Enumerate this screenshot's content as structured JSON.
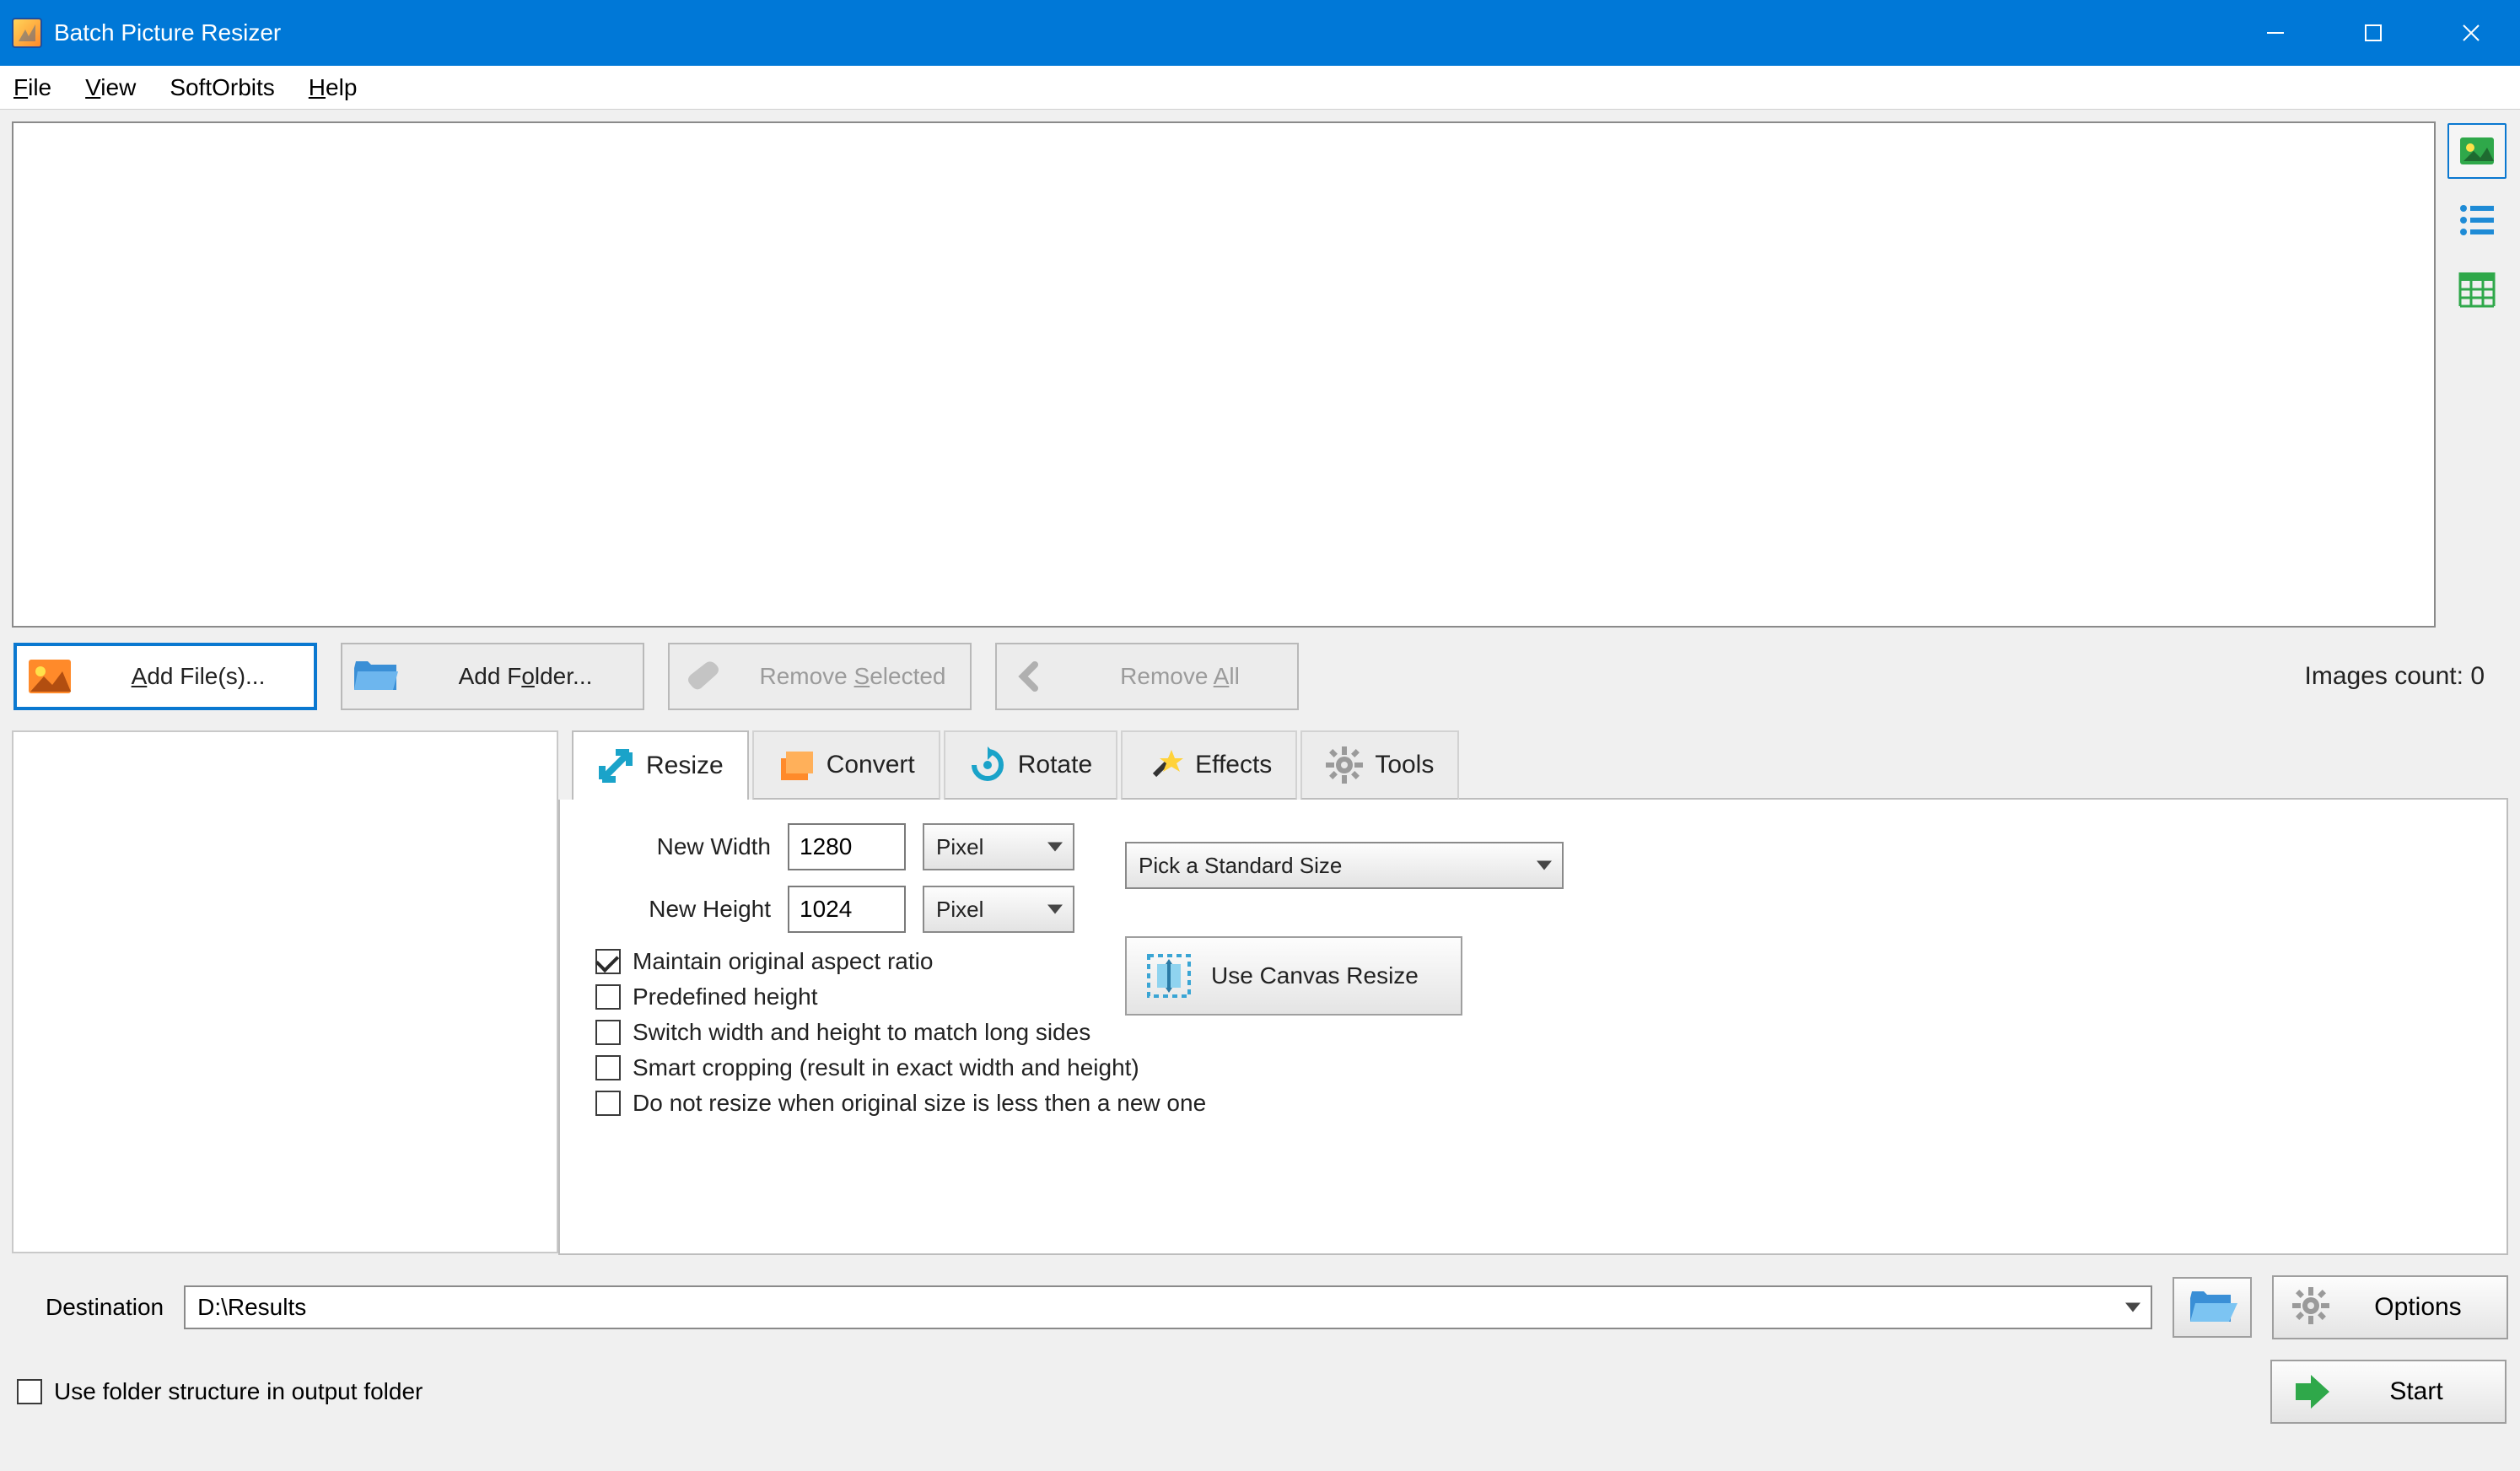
{
  "window": {
    "title": "Batch Picture Resizer"
  },
  "menu": {
    "file": "File",
    "view": "View",
    "softorbits": "SoftOrbits",
    "help": "Help"
  },
  "toolbar": {
    "add_files": "Add File(s)...",
    "add_folder": "Add Folder...",
    "remove_selected_pre": "Remove ",
    "remove_selected_ul": "S",
    "remove_selected_post": "elected",
    "remove_all_pre": "Remove ",
    "remove_all_ul": "A",
    "remove_all_post": "ll",
    "images_count_label": "Images count: ",
    "images_count_value": "0"
  },
  "tabs": {
    "resize": "Resize",
    "convert": "Convert",
    "rotate": "Rotate",
    "effects": "Effects",
    "tools": "Tools"
  },
  "resize": {
    "new_width_label": "New Width",
    "new_width_value": "1280",
    "width_unit": "Pixel",
    "new_height_label": "New Height",
    "new_height_value": "1024",
    "height_unit": "Pixel",
    "pick_standard": "Pick a Standard Size",
    "maintain_ratio": "Maintain original aspect ratio",
    "predefined_height": "Predefined height",
    "switch_sides": "Switch width and height to match long sides",
    "smart_cropping": "Smart cropping (result in exact width and height)",
    "no_resize_smaller": "Do not resize when original size is less then a new one",
    "use_canvas": "Use Canvas Resize"
  },
  "dest": {
    "label": "Destination",
    "value": "D:\\Results",
    "use_folder_structure": "Use folder structure in output folder",
    "options": "Options",
    "start": "Start"
  }
}
